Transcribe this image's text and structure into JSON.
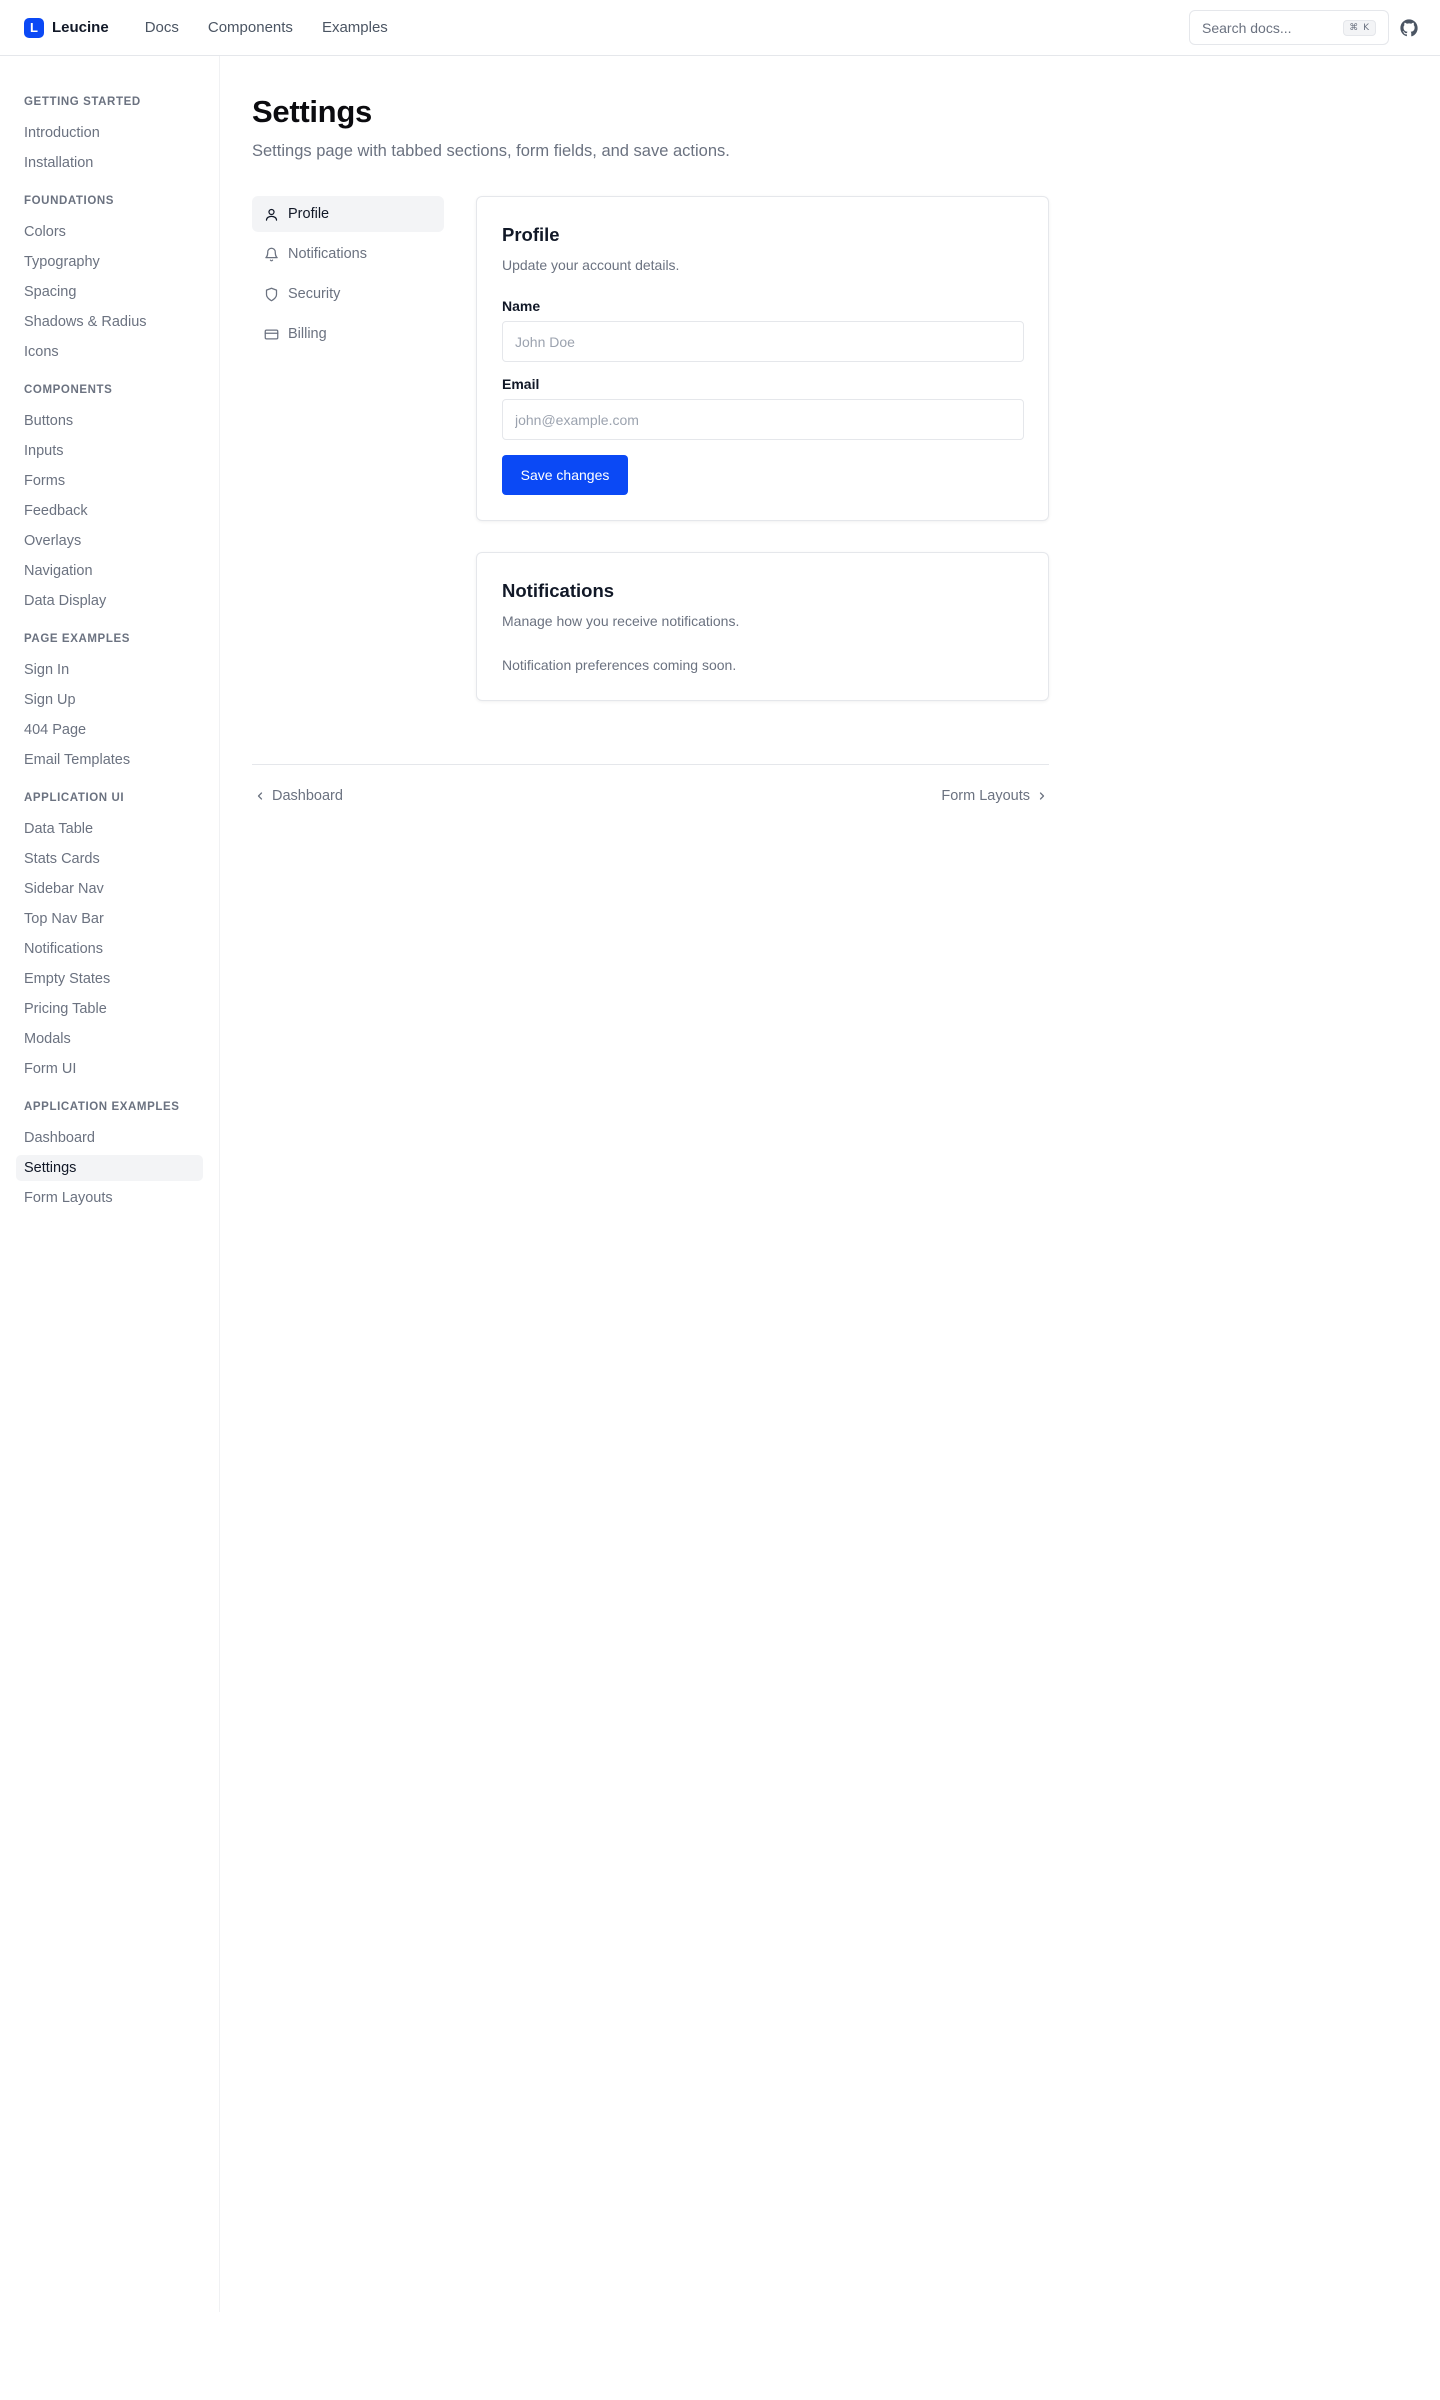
{
  "topbar": {
    "logo_letter": "L",
    "brand": "Leucine",
    "nav": [
      "Docs",
      "Components",
      "Examples"
    ],
    "search_placeholder": "Search docs...",
    "search_shortcut": "⌘ K"
  },
  "sidebar": {
    "groups": [
      {
        "title": "GETTING STARTED",
        "items": [
          "Introduction",
          "Installation"
        ]
      },
      {
        "title": "FOUNDATIONS",
        "items": [
          "Colors",
          "Typography",
          "Spacing",
          "Shadows & Radius",
          "Icons"
        ]
      },
      {
        "title": "COMPONENTS",
        "items": [
          "Buttons",
          "Inputs",
          "Forms",
          "Feedback",
          "Overlays",
          "Navigation",
          "Data Display"
        ]
      },
      {
        "title": "PAGE EXAMPLES",
        "items": [
          "Sign In",
          "Sign Up",
          "404 Page",
          "Email Templates"
        ]
      },
      {
        "title": "APPLICATION UI",
        "items": [
          "Data Table",
          "Stats Cards",
          "Sidebar Nav",
          "Top Nav Bar",
          "Notifications",
          "Empty States",
          "Pricing Table",
          "Modals",
          "Form UI"
        ]
      },
      {
        "title": "APPLICATION EXAMPLES",
        "items": [
          "Dashboard",
          "Settings",
          "Form Layouts"
        ]
      }
    ],
    "active_item": "Settings"
  },
  "page": {
    "title": "Settings",
    "subtitle": "Settings page with tabbed sections, form fields, and save actions."
  },
  "tabs": [
    {
      "label": "Profile",
      "icon": "user-icon",
      "active": true
    },
    {
      "label": "Notifications",
      "icon": "bell-icon",
      "active": false
    },
    {
      "label": "Security",
      "icon": "shield-icon",
      "active": false
    },
    {
      "label": "Billing",
      "icon": "credit-card-icon",
      "active": false
    }
  ],
  "profile_card": {
    "title": "Profile",
    "description": "Update your account details.",
    "name_label": "Name",
    "name_placeholder": "John Doe",
    "email_label": "Email",
    "email_placeholder": "john@example.com",
    "save_label": "Save changes"
  },
  "notifications_card": {
    "title": "Notifications",
    "description": "Manage how you receive notifications.",
    "note": "Notification preferences coming soon."
  },
  "pager": {
    "prev": "Dashboard",
    "next": "Form Layouts"
  },
  "colors": {
    "accent": "#0b49f5",
    "text": "#111827",
    "muted": "#6b7280",
    "border": "#e5e7eb",
    "active_bg": "#f3f4f6"
  }
}
